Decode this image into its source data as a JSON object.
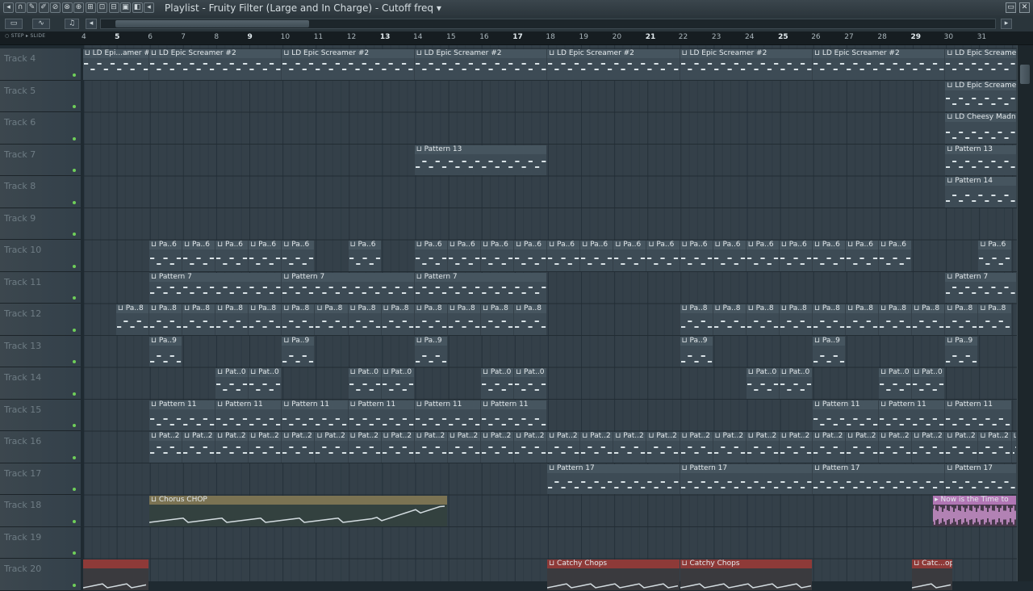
{
  "window": {
    "title": "Playlist - Fruity Filter (Large and In Charge) - Cutoff freq",
    "title_arrow": "▾",
    "min_label": "▭",
    "close_label": "✕",
    "toolbar_icons": [
      "menu-arrow-icon",
      "magnet-icon",
      "pencil-icon",
      "brush-icon",
      "delete-icon",
      "mute-icon",
      "slip-icon",
      "slice-icon",
      "select-icon",
      "zoom-icon",
      "playback-icon",
      "speaker-icon",
      "left-arrow-icon"
    ],
    "toolbar_glyphs": [
      "◂",
      "∩",
      "✎",
      "✐",
      "⊘",
      "⊗",
      "⊕",
      "⊞",
      "⊡",
      "⊟",
      "▣",
      "◧",
      "◂"
    ]
  },
  "toolbar2": {
    "pattern_icon": "▭",
    "curve_icon": "∿",
    "note_icon": "♫",
    "scroll_left": "◂",
    "scroll_right": "▸"
  },
  "ruler": {
    "snap": "○ STEP  ▸ SLIDE",
    "bars": [
      "4",
      "5",
      "6",
      "7",
      "8",
      "9",
      "10",
      "11",
      "12",
      "13",
      "14",
      "15",
      "16",
      "17",
      "18",
      "19",
      "20",
      "21",
      "22",
      "23",
      "24",
      "25",
      "26",
      "27",
      "28",
      "29",
      "30",
      "31"
    ],
    "major_bars": [
      "5",
      "9",
      "13",
      "17",
      "21",
      "25",
      "29"
    ]
  },
  "tracks": [
    "Track 4",
    "Track 5",
    "Track 6",
    "Track 7",
    "Track 8",
    "Track 9",
    "Track 10",
    "Track 11",
    "Track 12",
    "Track 13",
    "Track 14",
    "Track 15",
    "Track 16",
    "Track 17",
    "Track 18",
    "Track 19",
    "Track 20"
  ],
  "clip_labels": {
    "epic_short": "LD Epi...amer #2",
    "epic": "LD Epic Screamer #2",
    "epic_cut": "LD Epic Screame",
    "cheesy": "LD Cheesy Madne",
    "p13": "Pattern 13",
    "p14": "Pattern 14",
    "p6": "Pa..6",
    "p7": "Pattern 7",
    "p8": "Pa..8",
    "p9": "Pa..9",
    "p10": "Pat..0",
    "p11": "Pattern 11",
    "p12": "Pat..2",
    "p17": "Pattern 17",
    "chorus": "Chorus CHOP",
    "now": "Now is the Time to",
    "catchy": "Catchy Chops",
    "catchy_short": "Catc...ops"
  },
  "colors": {
    "pattern_clip": "#3d4b55",
    "audio_chorus": "#7b7353",
    "audio_now": "#b176b4",
    "audio_catchy": "#8e3a38",
    "grid": "#344049",
    "active_led": "#6fcf5a"
  },
  "arrangement": {
    "visible_bars": "4-31"
  }
}
